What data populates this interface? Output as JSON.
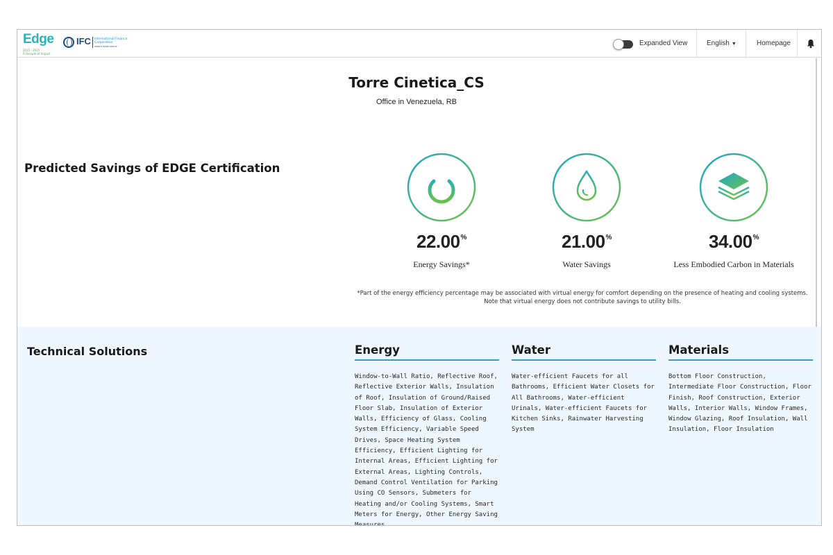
{
  "header": {
    "logo": {
      "edge_word": "Edge",
      "edge_years": "2015 - 2025",
      "edge_sub": "A Decade of Impact",
      "ifc_word": "IFC",
      "ifc_name": "International Finance Corporation",
      "ifc_tag": "WORLD BANK GROUP"
    },
    "expanded_view_label": "Expanded View",
    "expanded_view_on": false,
    "language": "English",
    "homepage": "Homepage",
    "notification_icon": "bell-icon"
  },
  "project": {
    "title": "Torre Cinetica_CS",
    "subtitle": "Office in Venezuela, RB"
  },
  "savings": {
    "heading": "Predicted Savings of EDGE Certification",
    "metrics": [
      {
        "icon": "power-icon",
        "value": "22.00",
        "unit": "%",
        "label": "Energy Savings*"
      },
      {
        "icon": "water-drop-icon",
        "value": "21.00",
        "unit": "%",
        "label": "Water Savings"
      },
      {
        "icon": "layers-icon",
        "value": "34.00",
        "unit": "%",
        "label": "Less Embodied Carbon in Materials"
      }
    ],
    "footnote": "*Part of the energy efficiency percentage may be associated with virtual energy for comfort depending on the presence of heating and cooling systems. Note that virtual energy does not contribute savings to utility bills."
  },
  "technical": {
    "heading": "Technical Solutions",
    "columns": [
      {
        "title": "Energy",
        "body": "Window-to-Wall Ratio, Reflective Roof, Reflective Exterior Walls, Insulation of Roof, Insulation of Ground/Raised Floor Slab, Insulation of Exterior Walls, Efficiency of Glass, Cooling System Efficiency, Variable Speed Drives, Space Heating System Efficiency, Efficient Lighting for Internal Areas, Efficient Lighting for External Areas, Lighting Controls, Demand Control Ventilation for Parking Using CO Sensors, Submeters for Heating and/or Cooling Systems, Smart Meters for Energy, Other Energy Saving Measures"
      },
      {
        "title": "Water",
        "body": "Water-efficient Faucets for all Bathrooms, Efficient Water Closets for All Bathrooms, Water-efficient Urinals, Water-efficient Faucets for Kitchen Sinks, Rainwater Harvesting System"
      },
      {
        "title": "Materials",
        "body": "Bottom Floor Construction, Intermediate Floor Construction, Floor Finish, Roof Construction, Exterior Walls, Interior Walls, Window Frames, Window Glazing, Roof Insulation, Wall Insulation, Floor Insulation"
      }
    ]
  },
  "colors": {
    "accent_blue": "#2a9fd8",
    "gradient_green": "#6cc24a",
    "gradient_teal": "#1fa7c9",
    "tech_background": "#eef7fd"
  }
}
